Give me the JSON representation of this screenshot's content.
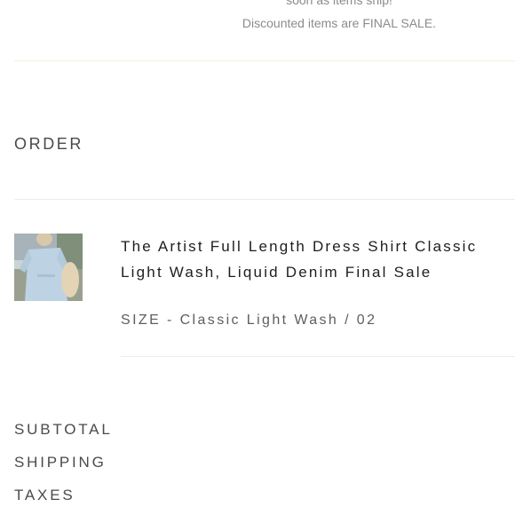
{
  "notice": {
    "line1": "soon as items ship!",
    "line2": "Discounted items are FINAL SALE."
  },
  "order": {
    "heading": "ORDER"
  },
  "item": {
    "title": "The Artist Full Length Dress Shirt Classic Light Wash, Liquid Denim Final Sale",
    "size": "SIZE - Classic Light Wash / 02",
    "image_alt": "Model wearing light wash denim shirt dress"
  },
  "summary": {
    "subtotal_label": "SUBTOTAL",
    "shipping_label": "SHIPPING",
    "taxes_label": "TAXES"
  }
}
